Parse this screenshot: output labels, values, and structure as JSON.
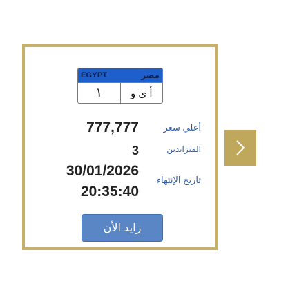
{
  "plate": {
    "country_en": "EGYPT",
    "country_ar": "مصر",
    "number": "١",
    "letters": "أ ى و"
  },
  "listing": {
    "price_label": "أعلي سعر",
    "price_value": "777,777",
    "bidders_label": "المتزايدين",
    "bidders_value": "3",
    "expiry_label": "تاريخ الإنتهاء",
    "expiry_date": "30/01/2026",
    "expiry_time": "20:35:40"
  },
  "actions": {
    "bid_label": "زايد الأن",
    "next_icon": "chevron-right-icon"
  },
  "colors": {
    "frame": "#c7b06a",
    "plate_header": "#1f5fcc",
    "label": "#2f5da8",
    "button": "#5b86c6",
    "next_button": "#bfa85c"
  }
}
